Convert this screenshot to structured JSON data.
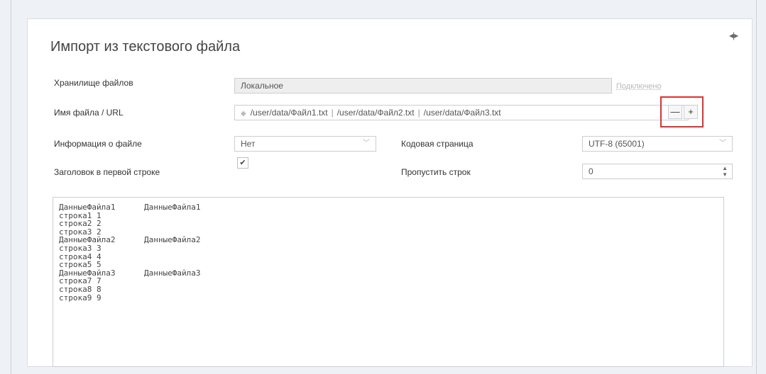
{
  "dialog": {
    "title": "Импорт из текстового файла",
    "collapse_icon": "◂|▸"
  },
  "storage": {
    "label": "Хранилище файлов",
    "value": "Локальное",
    "status_link": "Подключено"
  },
  "filename": {
    "label": "Имя файла / URL",
    "files": [
      "/user/data/Файл1.txt",
      "/user/data/Файл2.txt",
      "/user/data/Файл3.txt"
    ],
    "separator": "|",
    "remove_button": "—",
    "add_button": "+"
  },
  "file_info": {
    "label": "Информация о файле",
    "value": "Нет"
  },
  "codepage": {
    "label": "Кодовая страница",
    "value": "UTF-8 (65001)"
  },
  "header_row": {
    "label": "Заголовок в первой строке",
    "checked_mark": "✔"
  },
  "skip_rows": {
    "label": "Пропустить строк",
    "value": "0"
  },
  "preview": {
    "rows": [
      [
        "ДанныеФайла1",
        "ДанныеФайла1"
      ],
      [
        "строка1 1",
        ""
      ],
      [
        "строка2 2",
        ""
      ],
      [
        "строка3 2",
        ""
      ],
      [
        "ДанныеФайла2",
        "ДанныеФайла2"
      ],
      [
        "строка3 3",
        ""
      ],
      [
        "строка4 4",
        ""
      ],
      [
        "строка5 5",
        ""
      ],
      [
        "ДанныеФайла3",
        "ДанныеФайла3"
      ],
      [
        "строка7 7",
        ""
      ],
      [
        "строка8 8",
        ""
      ],
      [
        "строка9 9",
        ""
      ]
    ]
  }
}
